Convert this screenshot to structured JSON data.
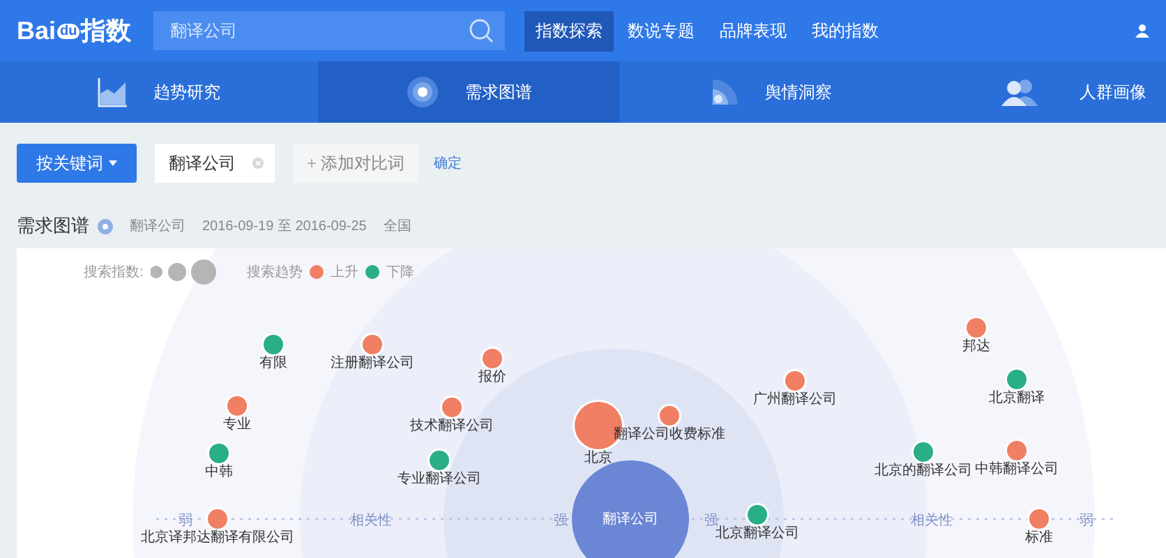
{
  "logo": {
    "text": "Bai",
    "paw_text": "du",
    "suffix": "指数"
  },
  "search": {
    "value": "翻译公司"
  },
  "main_nav": [
    {
      "label": "指数探索",
      "selected": true
    },
    {
      "label": "数说专题",
      "selected": false
    },
    {
      "label": "品牌表现",
      "selected": false
    },
    {
      "label": "我的指数",
      "selected": false
    }
  ],
  "sub_tabs": [
    {
      "label": "趋势研究",
      "kind": "trend",
      "selected": false
    },
    {
      "label": "需求图谱",
      "kind": "target",
      "selected": true
    },
    {
      "label": "舆情洞察",
      "kind": "wave",
      "selected": false
    },
    {
      "label": "人群画像",
      "kind": "people",
      "selected": false
    }
  ],
  "toolbar": {
    "mode_button": "按关键词",
    "keyword": "翻译公司",
    "add_icon": "+",
    "add_compare": "添加对比词",
    "confirm": "确定"
  },
  "heading": {
    "title": "需求图谱",
    "keyword": "翻译公司",
    "date_range": "2016-09-19 至 2016-09-25",
    "region": "全国"
  },
  "legend": {
    "size_label": "搜索指数:",
    "trend_label": "搜索趋势",
    "up": {
      "label": "上升",
      "color": "#f07f63"
    },
    "down": {
      "label": "下降",
      "color": "#2aae86"
    }
  },
  "axis_labels": [
    "弱",
    "相关性",
    "强",
    "强",
    "相关性",
    "弱"
  ],
  "nodes": [
    {
      "label": "有限",
      "kind": "term",
      "large": false,
      "color": "#2aae86"
    },
    {
      "label": "注册翻译公司",
      "kind": "term",
      "large": false,
      "color": "#f07f63"
    },
    {
      "label": "报价",
      "kind": "term",
      "large": false,
      "color": "#f07f63"
    },
    {
      "label": "专业",
      "kind": "term",
      "large": false,
      "color": "#f07f63"
    },
    {
      "label": "技术翻译公司",
      "kind": "term",
      "large": false,
      "color": "#f07f63"
    },
    {
      "label": "中韩",
      "kind": "term",
      "large": false,
      "color": "#2aae86"
    },
    {
      "label": "专业翻译公司",
      "kind": "term",
      "large": false,
      "color": "#2aae86"
    },
    {
      "label": "北京译邦达翻译有限公司",
      "kind": "term",
      "large": false,
      "color": "#f07f63"
    },
    {
      "label": "北京",
      "kind": "term",
      "large": true,
      "color": "#f07f63"
    },
    {
      "label": "翻译公司收费标准",
      "kind": "term",
      "large": false,
      "color": "#f07f63"
    },
    {
      "label": "翻译公司",
      "kind": "keyword",
      "color": "#6b86d4"
    },
    {
      "label": "北京翻译公司",
      "kind": "term",
      "large": false,
      "color": "#2aae86"
    },
    {
      "label": "广州翻译公司",
      "kind": "term",
      "large": false,
      "color": "#f07f63"
    },
    {
      "label": "邦达",
      "kind": "term",
      "large": false,
      "color": "#f07f63"
    },
    {
      "label": "北京翻译",
      "kind": "term",
      "large": false,
      "color": "#2aae86"
    },
    {
      "label": "北京的翻译公司",
      "kind": "term",
      "large": false,
      "color": "#2aae86"
    },
    {
      "label": "中韩翻译公司",
      "kind": "term",
      "large": false,
      "color": "#f07f63"
    },
    {
      "label": "标准",
      "kind": "term",
      "large": false,
      "color": "#f07f63"
    }
  ]
}
